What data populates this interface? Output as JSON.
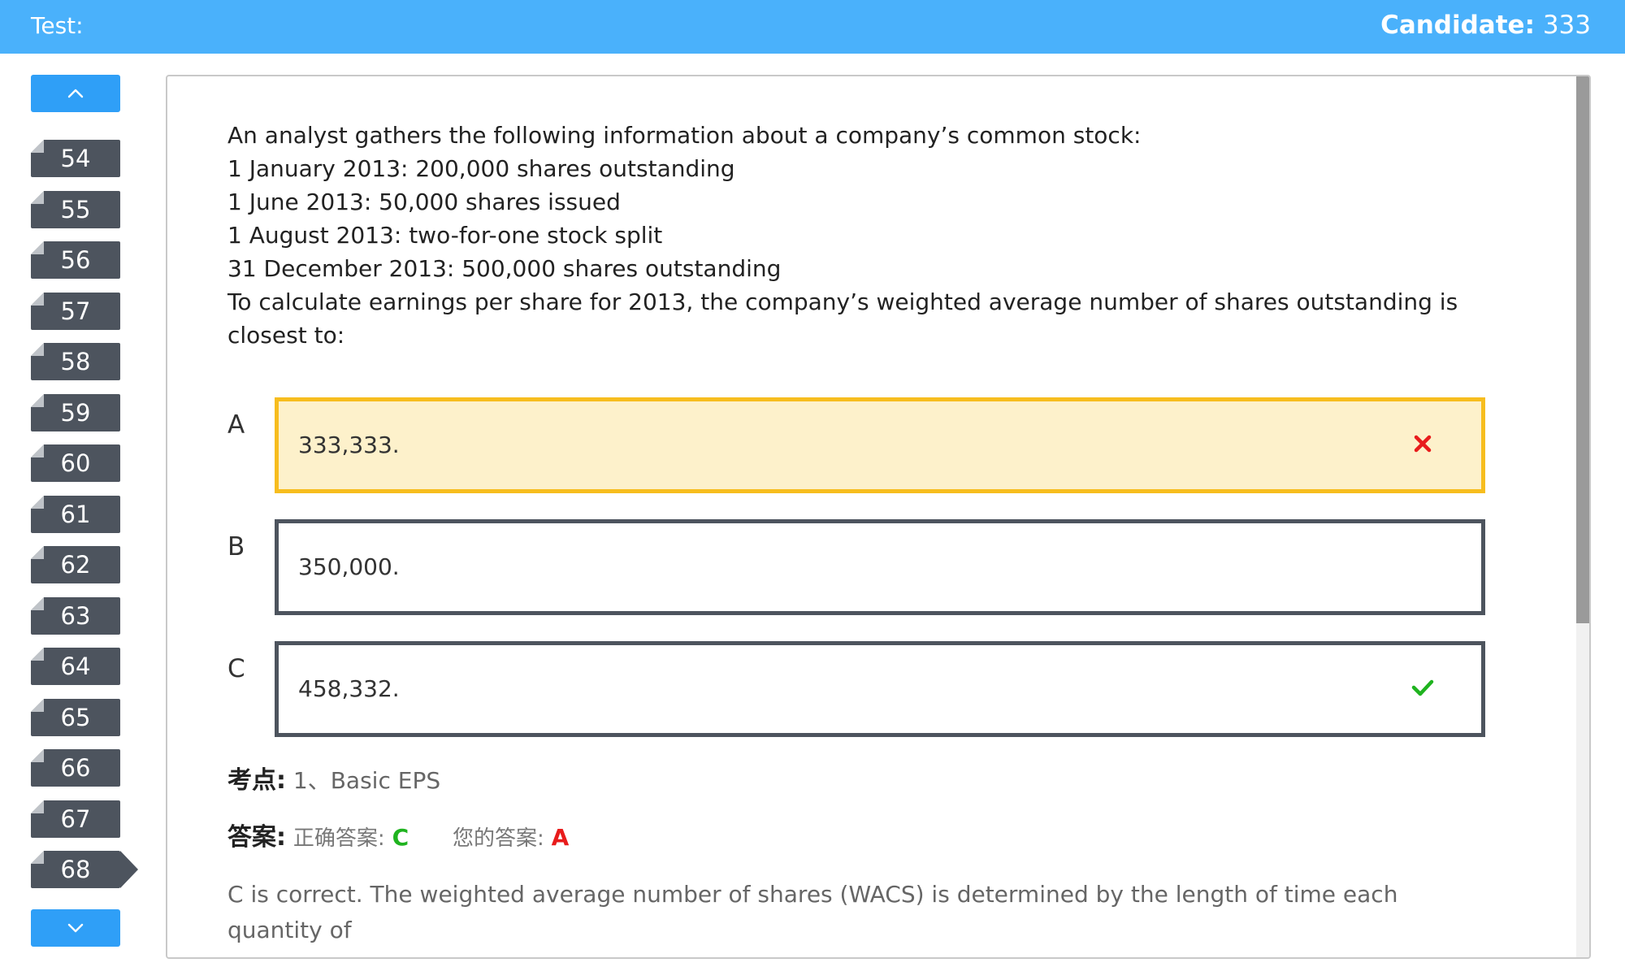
{
  "header": {
    "test_label": "Test:",
    "candidate_label": "Candidate:",
    "candidate_value": "333",
    "bg_color": "#4ab1fb"
  },
  "sidebar": {
    "up_icon": "chevron-up-icon",
    "down_icon": "chevron-down-icon",
    "items": [
      {
        "label": "54"
      },
      {
        "label": "55"
      },
      {
        "label": "56"
      },
      {
        "label": "57"
      },
      {
        "label": "58"
      },
      {
        "label": "59"
      },
      {
        "label": "60"
      },
      {
        "label": "61"
      },
      {
        "label": "62"
      },
      {
        "label": "63"
      },
      {
        "label": "64"
      },
      {
        "label": "65"
      },
      {
        "label": "66"
      },
      {
        "label": "67"
      },
      {
        "label": "68"
      }
    ],
    "active_item": "68"
  },
  "question": {
    "lines": [
      "An analyst gathers the following information about a company’s common stock:",
      "1 January 2013: 200,000 shares outstanding",
      "1 June 2013: 50,000 shares issued",
      "1 August 2013: two-for-one stock split",
      "31 December 2013: 500,000 shares outstanding",
      "To calculate earnings per share for 2013, the company’s weighted average number of shares outstanding is closest to:"
    ],
    "options": [
      {
        "letter": "A",
        "text": "333,333.",
        "state": "wrong",
        "mark_icon": "cross-icon"
      },
      {
        "letter": "B",
        "text": "350,000.",
        "state": "normal",
        "mark_icon": ""
      },
      {
        "letter": "C",
        "text": "458,332.",
        "state": "correct",
        "mark_icon": "check-icon"
      }
    ]
  },
  "meta": {
    "point_label": "考点:",
    "point_value": "1、Basic EPS",
    "answer_label": "答案:",
    "correct_label": "正确答案:",
    "correct_value": "C",
    "yours_label": "您的答案:",
    "yours_value": "A",
    "explanation": "C is correct. The weighted average number of shares (WACS) is determined by the length of time each quantity of"
  },
  "colors": {
    "accent": "#2f9ff7",
    "nav_item": "#4d545e",
    "wrong_border": "#f7bd1e",
    "wrong_fill": "#fdf1cb",
    "correct": "#1fb31f",
    "incorrect": "#e81c1c"
  }
}
